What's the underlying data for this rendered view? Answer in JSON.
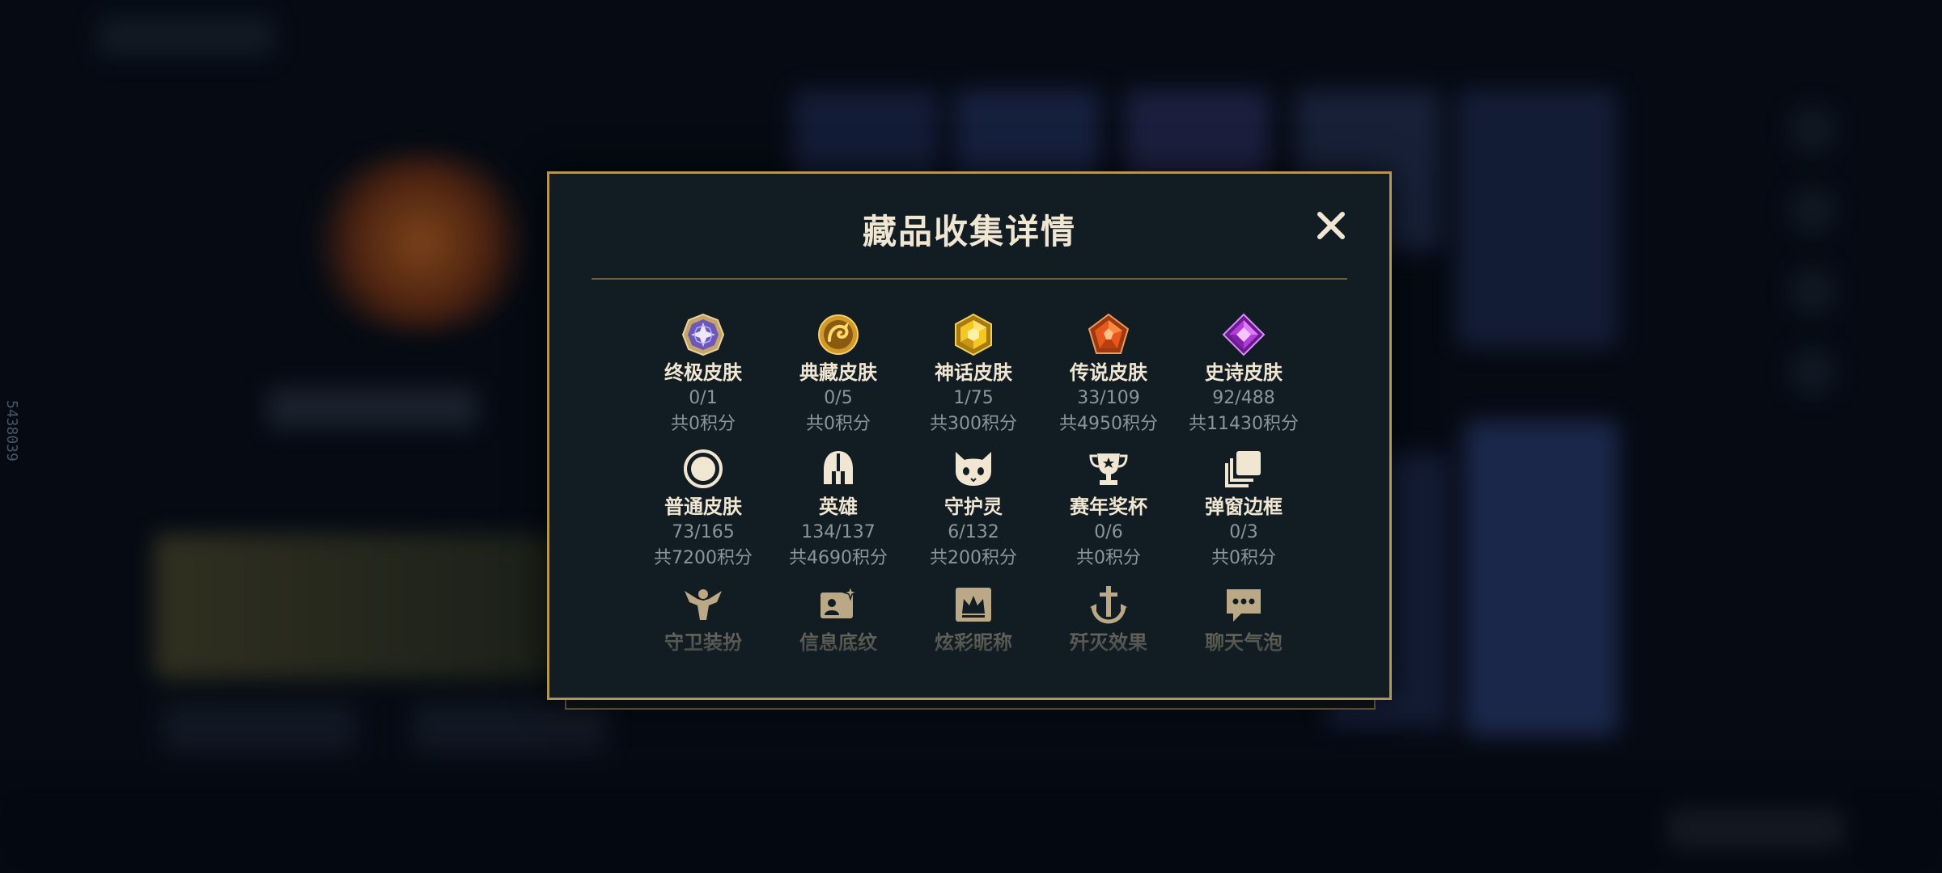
{
  "side_id": "5438039",
  "dialog": {
    "title": "藏品收集详情",
    "close_label": "✕"
  },
  "items": [
    {
      "name": "终极皮肤",
      "count": "0/1",
      "points": "共0积分",
      "icon": "ultimate-skin-icon"
    },
    {
      "name": "典藏皮肤",
      "count": "0/5",
      "points": "共0积分",
      "icon": "prestige-skin-icon"
    },
    {
      "name": "神话皮肤",
      "count": "1/75",
      "points": "共300积分",
      "icon": "mythic-skin-icon"
    },
    {
      "name": "传说皮肤",
      "count": "33/109",
      "points": "共4950积分",
      "icon": "legendary-skin-icon"
    },
    {
      "name": "史诗皮肤",
      "count": "92/488",
      "points": "共11430积分",
      "icon": "epic-skin-icon"
    },
    {
      "name": "普通皮肤",
      "count": "73/165",
      "points": "共7200积分",
      "icon": "standard-skin-icon"
    },
    {
      "name": "英雄",
      "count": "134/137",
      "points": "共4690积分",
      "icon": "champion-helmet-icon"
    },
    {
      "name": "守护灵",
      "count": "6/132",
      "points": "共200积分",
      "icon": "guardian-spirit-icon"
    },
    {
      "name": "赛年奖杯",
      "count": "0/6",
      "points": "共0积分",
      "icon": "trophy-icon"
    },
    {
      "name": "弹窗边框",
      "count": "0/3",
      "points": "共0积分",
      "icon": "popup-frame-icon"
    },
    {
      "name": "守卫装扮",
      "icon": "ward-skin-icon"
    },
    {
      "name": "信息底纹",
      "icon": "info-card-icon"
    },
    {
      "name": "炫彩昵称",
      "icon": "nickname-icon"
    },
    {
      "name": "歼灭效果",
      "icon": "elimination-effect-icon"
    },
    {
      "name": "聊天气泡",
      "icon": "chat-bubble-icon"
    }
  ],
  "colors": {
    "gold_border": "#b39556",
    "dialog_bg": "#111c23",
    "title": "#f0e6d2",
    "muted": "#8c949c"
  }
}
